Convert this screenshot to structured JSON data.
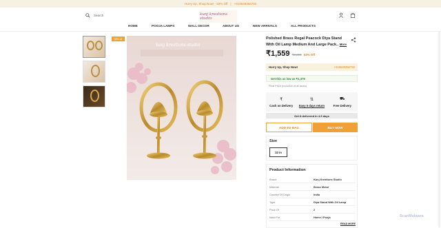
{
  "announcement": {
    "message": "Hurry Up, Shop Now! - 50% Off",
    "separator": "|",
    "phone": "+919549356792"
  },
  "header": {
    "search_label": "Search",
    "logo_text": "kunj kreations studio"
  },
  "nav": {
    "items": [
      "HOME",
      "POOJA LAMPS",
      "WALL DECOR",
      "ABOUT US",
      "NEW ARRIVALS",
      "ALL PRODUCTS"
    ]
  },
  "gallery": {
    "badge": "53% off",
    "image_logo": "kunj kreations studio"
  },
  "product": {
    "title": "Polished Brass Regal Peacock Diya Stand With Oil Lamp Medium And Large Pack..",
    "more_label": "More",
    "price": "₹1,559",
    "mrp": "₹3,299",
    "discount": "53% Off"
  },
  "hurry": {
    "label": "Hurry Up, Shop Now!",
    "phone": "+919549356792"
  },
  "offer": {
    "text": "Get this as low as ₹1,379"
  },
  "inclusive": {
    "text": "Final Price (inclusive of all taxes)"
  },
  "features": [
    {
      "icon": "cash-icon",
      "label": "Cash on Delivery"
    },
    {
      "icon": "return-icon",
      "label": "Easy 5 days return"
    },
    {
      "icon": "truck-icon",
      "label": "Free Delivery"
    }
  ],
  "delivery_note": "Get it delivered in 4-9 days",
  "buttons": {
    "add_to_bag": "ADD TO BAG",
    "buy_now": "BUY NOW"
  },
  "size": {
    "heading": "Size",
    "selected": "10 in"
  },
  "info": {
    "heading": "Product Information",
    "rows": [
      {
        "k": "Brand",
        "v": "Kunj Kreations Studio"
      },
      {
        "k": "Material",
        "v": "Brass Metal"
      },
      {
        "k": "Country Of Origin",
        "v": "India"
      },
      {
        "k": "Type",
        "v": "Diya Stand With Oil Lamp"
      },
      {
        "k": "Pack Of",
        "v": "2"
      },
      {
        "k": "Ideal For",
        "v": "Home / Pooja"
      }
    ],
    "read_more": "READ MORE"
  },
  "watermark": "ScanMalware"
}
